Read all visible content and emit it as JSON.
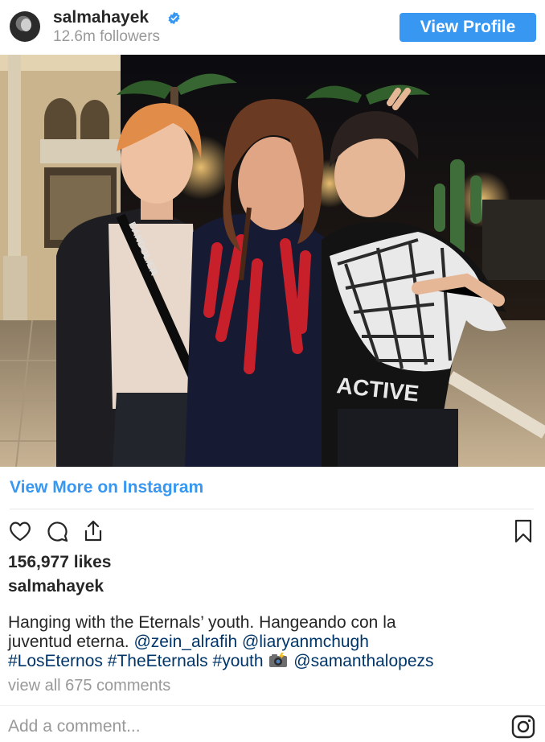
{
  "post": {
    "username": "salmahayek",
    "followers": "12.6m followers",
    "view_profile_label": "View Profile",
    "view_more_label": "View More on Instagram",
    "likes": "156,977 likes",
    "caption_username": "salmahayek",
    "caption": {
      "line1": "Hanging with the Eternals’ youth. Hangeando con la",
      "line2_text": "juventud eterna.",
      "mention1": "@zein_alrafih",
      "mention2": "@liaryanmchugh",
      "hashtag1": "#LosEternos",
      "hashtag2": "#TheEternals",
      "hashtag3": "#youth",
      "mention3": "@samanthalopezs"
    },
    "comments_label": "view all 675 comments",
    "comment_placeholder": "Add a comment..."
  },
  "photo_text": {
    "strap_text": "BANDOLIER",
    "shirt_text": "ACTIVE"
  },
  "icons": {
    "verified": "verified-badge-icon",
    "like": "heart-icon",
    "comment": "comment-bubble-icon",
    "share": "share-icon",
    "save": "bookmark-icon",
    "logo": "instagram-icon",
    "camera": "camera-flash-emoji"
  },
  "colors": {
    "accent": "#3897f0",
    "link": "#003569",
    "muted": "#999999",
    "text": "#262626"
  }
}
